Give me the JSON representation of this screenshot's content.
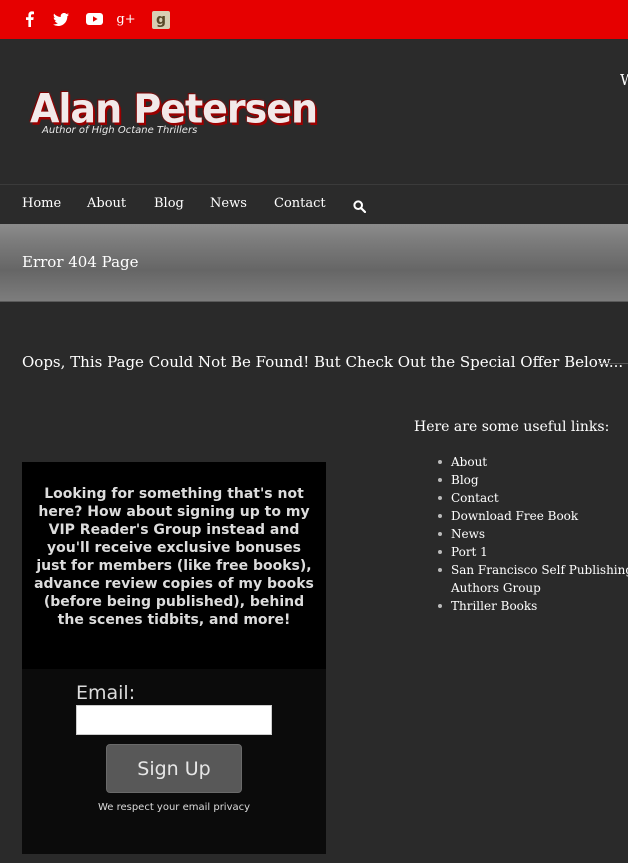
{
  "social": {
    "icons": [
      "facebook-icon",
      "twitter-icon",
      "youtube-icon",
      "google-plus-icon",
      "goodreads-icon"
    ],
    "google_plus_glyph": "g+",
    "goodreads_glyph": "g"
  },
  "header": {
    "logo_name": "Alan Petersen",
    "logo_tagline": "Author of High Octane Thrillers",
    "cut_text": "W"
  },
  "nav": {
    "items": [
      "Home",
      "About",
      "Blog",
      "News",
      "Contact"
    ],
    "search_icon": "search-icon"
  },
  "page_title": "Error 404 Page",
  "heading": "Oops, This Page Could Not Be Found! But Check Out the Special Offer Below...",
  "useful_links": {
    "title": "Here are some useful links:",
    "items": [
      "About",
      "Blog",
      "Contact",
      "Download Free Book",
      "News",
      "Port 1",
      "San Francisco Self Publishing Authors Group",
      "Thriller Books"
    ]
  },
  "optin": {
    "text": "Looking for something that's not here? How about signing up to my VIP Reader's Group instead and you'll receive exclusive bonuses just for members (like free books), advance review copies of my books (before being published), behind the scenes tidbits, and more!",
    "email_label": "Email:",
    "email_value": "",
    "button_label": "Sign Up",
    "privacy_note": "We respect your email privacy"
  },
  "colors": {
    "topbar": "#e60000",
    "background": "#2a2a2a",
    "logo_shadow": "#9a0000",
    "optin_bg": "#000000",
    "button_bg": "#585858"
  }
}
